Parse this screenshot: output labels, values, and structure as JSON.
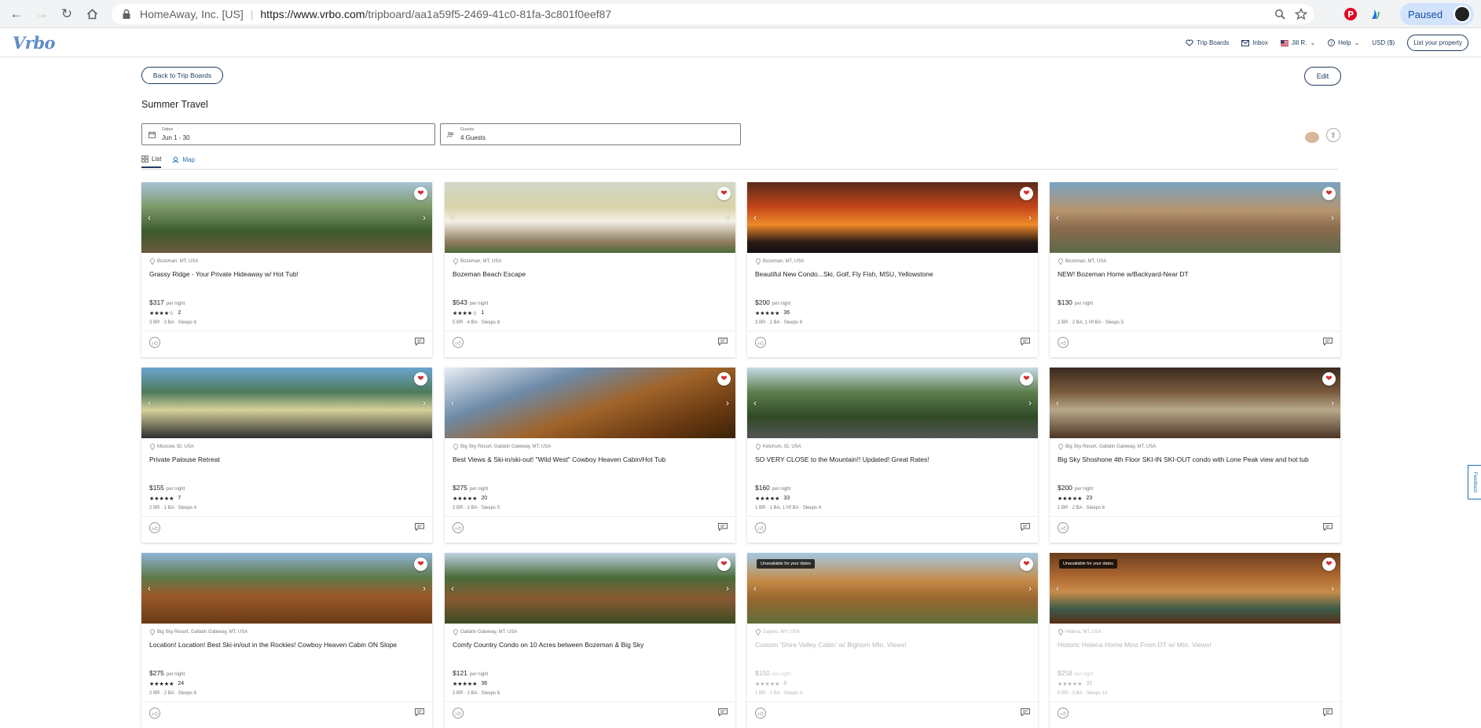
{
  "browser": {
    "org": "HomeAway, Inc. [US]",
    "url_host": "https://www.vrbo.com",
    "url_path": "/tripboard/aa1a59f5-2469-41c0-81fa-3c801f0eef87",
    "paused_label": "Paused"
  },
  "header": {
    "logo": "Vrbo",
    "trip_boards": "Trip Boards",
    "inbox": "Inbox",
    "user": "Jill R.",
    "help": "Help",
    "currency": "USD ($)",
    "list_property": "List your property"
  },
  "board": {
    "back_label": "Back to Trip Boards",
    "edit_label": "Edit",
    "title": "Summer Travel",
    "dates_label": "Dates",
    "dates_value": "Jun 1 - 30",
    "guests_label": "Guests",
    "guests_value": "4 Guests",
    "tab_list": "List",
    "tab_map": "Map"
  },
  "feedback_label": "Feedback",
  "listings": [
    {
      "location": "Bozeman, MT, USA",
      "name": "Grassy Ridge - Your Private Hideaway w/ Hot Tub!",
      "price": "$317",
      "per_night": "per night",
      "stars": "★★★★☆",
      "reviews": "2",
      "details": "3 BR · 3 BA · Sleeps 6",
      "unavailable": ""
    },
    {
      "location": "Bozeman, MT, USA",
      "name": "Bozeman Beach Escape",
      "price": "$543",
      "per_night": "per night",
      "stars": "★★★★☆",
      "reviews": "1",
      "details": "5 BR · 4 BA · Sleeps 8",
      "unavailable": ""
    },
    {
      "location": "Bozeman, MT, USA",
      "name": "Beautiful New Condo...Ski, Golf, Fly Fish, MSU, Yellowstone",
      "price": "$200",
      "per_night": "per night",
      "stars": "★★★★★",
      "reviews": "36",
      "details": "3 BR · 2 BA · Sleeps 9",
      "unavailable": ""
    },
    {
      "location": "Bozeman, MT, USA",
      "name": "NEW! Bozeman Home w/Backyard-Near DT",
      "price": "$130",
      "per_night": "per night",
      "stars": "",
      "reviews": "",
      "details": "2 BR · 2 BA, 1 Hf BA · Sleeps 5",
      "unavailable": ""
    },
    {
      "location": "Moscow, ID, USA",
      "name": "Private Palouse Retreat",
      "price": "$155",
      "per_night": "per night",
      "stars": "★★★★★",
      "reviews": "7",
      "details": "2 BR · 1 BA · Sleeps 4",
      "unavailable": ""
    },
    {
      "location": "Big Sky Resort, Gallatin Gateway, MT, USA",
      "name": "Best Views & Ski-in/ski-out! \"Wild West\" Cowboy Heaven Cabin/Hot Tub",
      "price": "$275",
      "per_night": "per night",
      "stars": "★★★★★",
      "reviews": "20",
      "details": "2 BR · 2 BA · Sleeps 5",
      "unavailable": ""
    },
    {
      "location": "Ketchum, ID, USA",
      "name": "SO VERY CLOSE to the Mountain!! Updated! Great Rates!",
      "price": "$160",
      "per_night": "per night",
      "stars": "★★★★★",
      "reviews": "33",
      "details": "1 BR · 1 BA, 1 Hf BA · Sleeps 4",
      "unavailable": ""
    },
    {
      "location": "Big Sky Resort, Gallatin Gateway, MT, USA",
      "name": "Big Sky Shoshone 4th Floor SKI-IN SKI-OUT condo with Lone Peak view and hot tub",
      "price": "$200",
      "per_night": "per night",
      "stars": "★★★★★",
      "reviews": "23",
      "details": "1 BR · 2 BA · Sleeps 6",
      "unavailable": ""
    },
    {
      "location": "Big Sky Resort, Gallatin Gateway, MT, USA",
      "name": "Location! Location! Best Ski-in/out in the Rockies! Cowboy Heaven Cabin ON Slope",
      "price": "$275",
      "per_night": "per night",
      "stars": "★★★★★",
      "reviews": "24",
      "details": "2 BR · 2 BA · Sleeps 6",
      "unavailable": ""
    },
    {
      "location": "Gallatin Gateway, MT, USA",
      "name": "Comfy Country Condo on 10 Acres between Bozeman & Big Sky",
      "price": "$121",
      "per_night": "per night",
      "stars": "★★★★★",
      "reviews": "36",
      "details": "2 BR · 2 BA · Sleeps 6",
      "unavailable": ""
    },
    {
      "location": "Dayton, WY, USA",
      "name": "Custom 'Shire Valley Cabin' w/ Bighorn Mtn. Views!",
      "price": "$150",
      "per_night": "per night",
      "stars": "★★★★★",
      "reviews": "8",
      "details": "1 BR · 1 BA · Sleeps 4",
      "unavailable": "Unavailable for your dates"
    },
    {
      "location": "Helena, MT, USA",
      "name": "Historic Helena Home Mins From DT w/ Mtn. Views!",
      "price": "$258",
      "per_night": "per night",
      "stars": "★★★★★",
      "reviews": "32",
      "details": "5 BR · 3 BA · Sleeps 13",
      "unavailable": "Unavailable for your dates"
    }
  ]
}
